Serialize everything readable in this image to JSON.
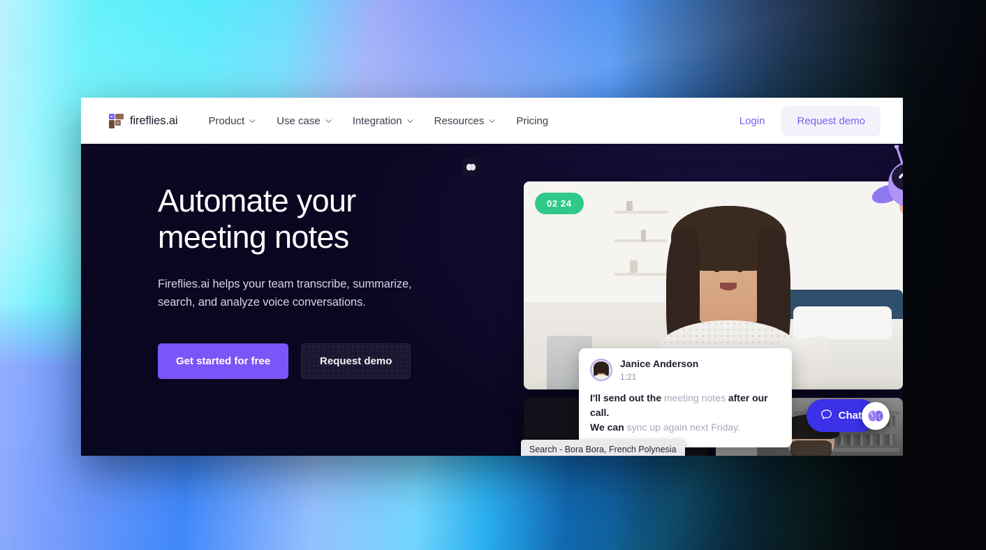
{
  "nav": {
    "brand": "fireflies.ai",
    "links": [
      {
        "label": "Product",
        "has_chevron": true,
        "icon": "chevron-down-icon"
      },
      {
        "label": "Use case",
        "has_chevron": true,
        "icon": "chevron-down-icon"
      },
      {
        "label": "Integration",
        "has_chevron": true,
        "icon": "chevron-down-icon"
      },
      {
        "label": "Resources",
        "has_chevron": true,
        "icon": "chevron-down-icon"
      },
      {
        "label": "Pricing",
        "has_chevron": false,
        "icon": ""
      }
    ],
    "login_label": "Login",
    "demo_label": "Request demo",
    "accent_color": "#7b5cf5"
  },
  "hero": {
    "title": "Automate your\nmeeting notes",
    "subtitle": "Fireflies.ai helps your team transcribe, summarize,\nsearch, and analyze voice conversations.",
    "primary_cta": "Get started for free",
    "secondary_cta": "Request demo",
    "primary_color": "#7b55f8",
    "background_color": "#0a0720",
    "brain_chip_icon": "brain-icon"
  },
  "media": {
    "timer": "02 24",
    "timer_color": "#2fc98a",
    "mascot_icon": "firefly-mascot-icon",
    "chat_card": {
      "author": "Janice Anderson",
      "time": "1:21",
      "line1_a": "I'll send out the ",
      "line1_b": "meeting notes",
      "line1_c": " after our call.",
      "line2_a": "We can ",
      "line2_b": "sync up again next Friday.",
      "avatar_icon": "avatar"
    },
    "search_tooltip": "Search - Bora Bora, French Polynesia",
    "tile_logo_icon": "fireflies-logo-icon"
  },
  "chat_widget": {
    "label": "Chat",
    "bubble_icon": "speech-bubble-icon",
    "brain_icon": "brain-icon",
    "color": "#3b31e8"
  }
}
